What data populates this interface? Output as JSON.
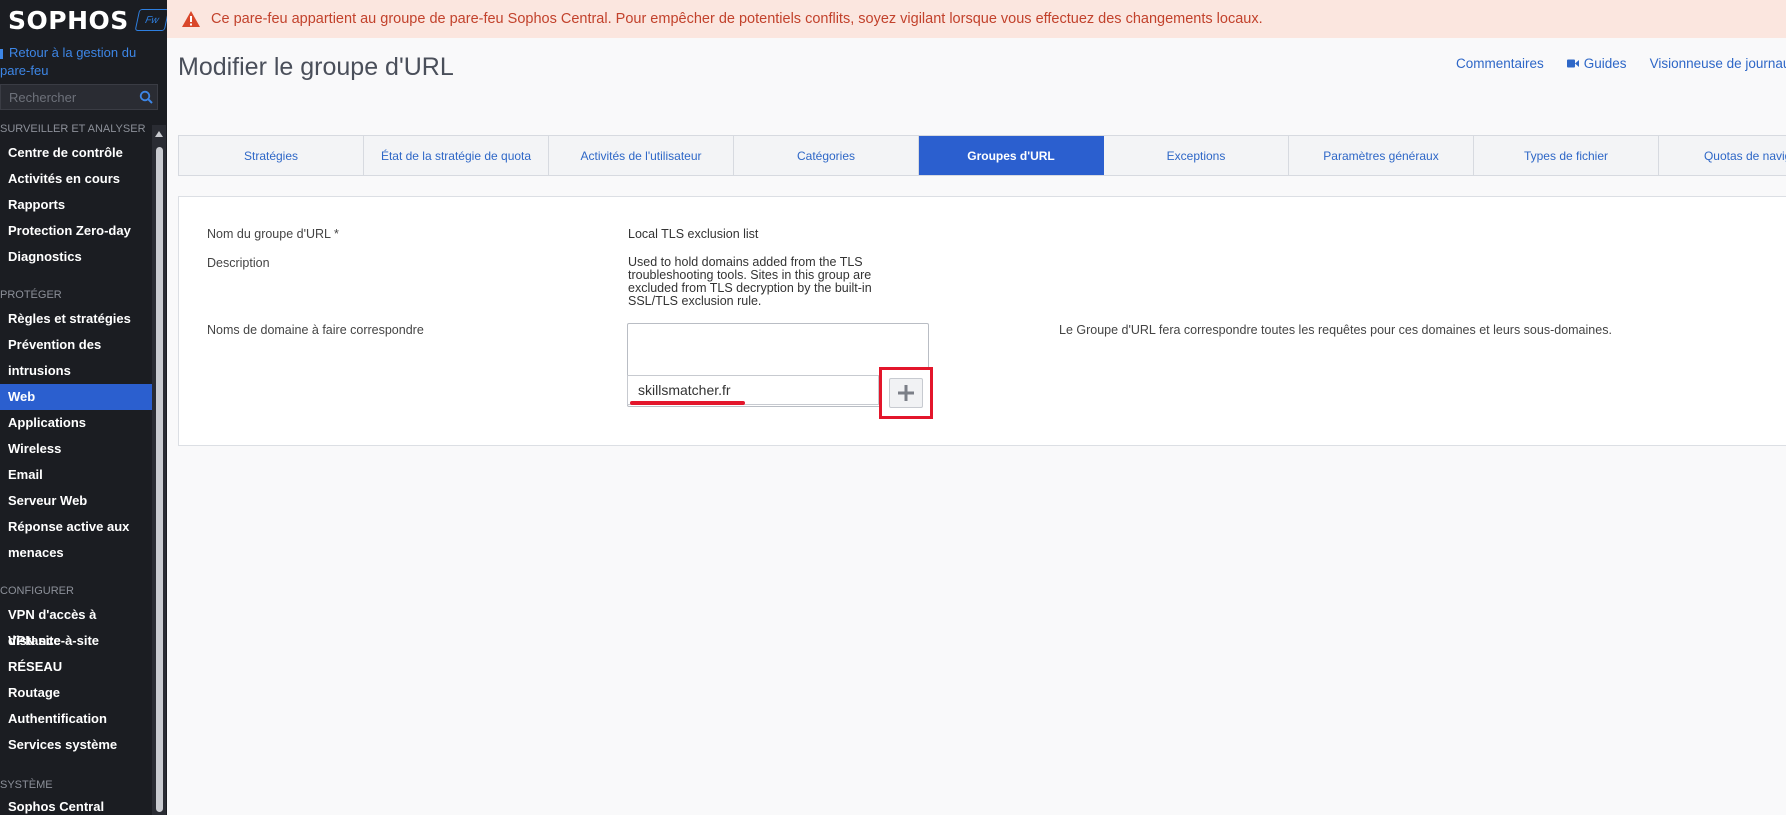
{
  "sidebar": {
    "logo_text": "SOPHOS",
    "logo_badge": "Fw",
    "back_link": "Retour à la gestion du pare-feu",
    "search_placeholder": "Rechercher",
    "sections": {
      "monitor": "SURVEILLER ET ANALYSER",
      "protect": "PROTÉGER",
      "configure": "CONFIGURER",
      "system": "SYSTÈME"
    },
    "monitor_items": [
      "Centre de contrôle",
      "Activités en cours",
      "Rapports",
      "Protection Zero-day",
      "Diagnostics"
    ],
    "protect_items": [
      "Règles et stratégies",
      "Prévention des",
      "intrusions",
      "Web",
      "Applications",
      "Wireless",
      "Email",
      "Serveur Web",
      "Réponse active aux",
      "menaces"
    ],
    "configure_items": [
      "VPN d'accès à distance",
      "VPN site-à-site",
      "RÉSEAU",
      "Routage",
      "Authentification",
      "Services système"
    ],
    "system_items": [
      "Sophos Central"
    ],
    "active_item": "Web"
  },
  "banner": {
    "text": "Ce pare-feu appartient au groupe de pare-feu Sophos Central. Pour empêcher de potentiels conflits, soyez vigilant lorsque vous effectuez des changements locaux."
  },
  "header": {
    "title": "Modifier le groupe d'URL",
    "links": [
      "Commentaires",
      "Guides",
      "Visionneuse de journaux"
    ]
  },
  "tabs": [
    {
      "label": "Stratégies"
    },
    {
      "label": "État de la stratégie de quota"
    },
    {
      "label": "Activités de l'utilisateur"
    },
    {
      "label": "Catégories"
    },
    {
      "label": "Groupes d'URL"
    },
    {
      "label": "Exceptions"
    },
    {
      "label": "Paramètres généraux"
    },
    {
      "label": "Types de fichier"
    },
    {
      "label": "Quotas de naviga"
    }
  ],
  "active_tab": "Groupes d'URL",
  "form": {
    "name_label": "Nom du groupe d'URL *",
    "name_value": "Local TLS exclusion list",
    "description_label": "Description",
    "description_lines": [
      "Used to hold domains added from the TLS",
      "troubleshooting tools. Sites in this group are",
      "excluded from TLS decryption by the built-in",
      "SSL/TLS exclusion rule."
    ],
    "domains_label": "Noms de domaine à faire correspondre",
    "domain_input_value": "skillsmatcher.fr",
    "add_button_symbol": "+",
    "domains_hint": "Le Groupe d'URL fera correspondre toutes les requêtes pour ces domaines et leurs sous-domaines."
  },
  "colors": {
    "accent": "#2b5fcf",
    "warning_text": "#c2422c",
    "warning_bg": "#fbe6df",
    "highlight": "#e3162b"
  },
  "icons": {
    "search": "search-icon",
    "warning": "warning-icon",
    "video": "video-icon",
    "add": "plus-icon"
  }
}
